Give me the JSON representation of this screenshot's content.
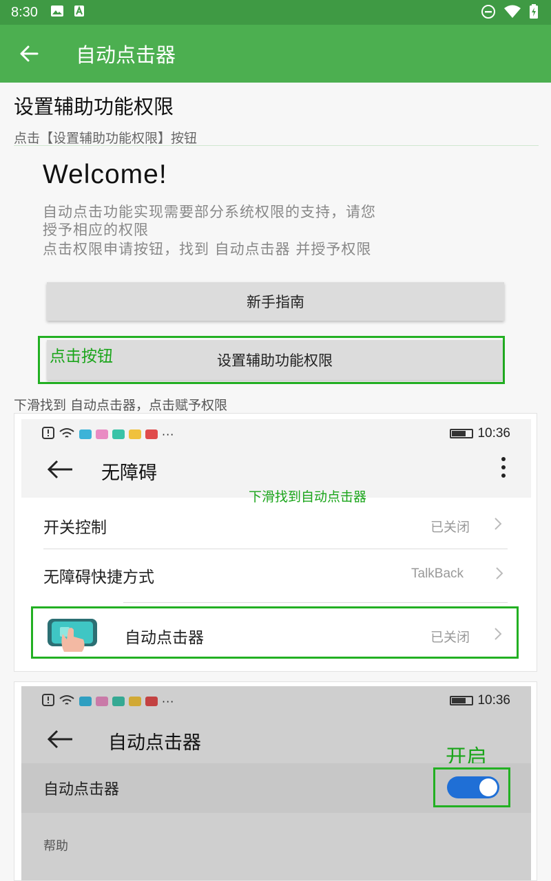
{
  "status_bar": {
    "time": "8:30"
  },
  "app_bar": {
    "title": "自动点击器"
  },
  "section": {
    "title": "设置辅助功能权限",
    "subtitle": "点击【设置辅助功能权限】按钮"
  },
  "welcome": {
    "title": "Welcome!",
    "line1": "自动点击功能实现需要部分系统权限的支持，请您",
    "line2": "授予相应的权限",
    "line3": "点击权限申请按钮，找到 自动点击器 并授予权限"
  },
  "buttons": {
    "guide_label": "新手指南",
    "permission_label": "设置辅助功能权限",
    "permission_annotation": "点击按钮"
  },
  "step2": {
    "label": "下滑找到 自动点击器，点击赋予权限"
  },
  "screenshot1": {
    "time": "10:36",
    "title": "无障碍",
    "annotation": "下滑找到自动点击器",
    "rows": [
      {
        "label": "开关控制",
        "value": "已关闭"
      },
      {
        "label": "无障碍快捷方式",
        "value": "TalkBack"
      },
      {
        "label": "自动点击器",
        "value": "已关闭"
      }
    ]
  },
  "screenshot2": {
    "time": "10:36",
    "title": "自动点击器",
    "annotation": "开启",
    "row_label": "自动点击器",
    "help_label": "帮助",
    "toggle_on": true
  },
  "colors": {
    "status_bar": "#3f9a44",
    "app_bar": "#4caf50",
    "annotation_green": "#1aa51a",
    "toggle_blue": "#1f6fd6"
  }
}
